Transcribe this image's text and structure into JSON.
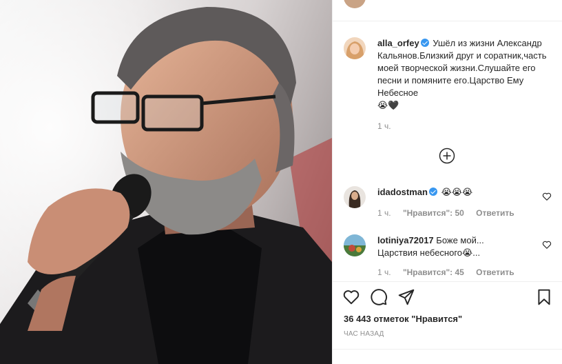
{
  "post": {
    "photo_alt": "",
    "author": "alla_orfey",
    "caption": "Ушёл из жизни Александр Кальянов.Близкий друг и соратник,часть моей творческой жизни.Слушайте его песни и помяните его.Царство Ему Небесное",
    "caption_emoji": "😭🖤",
    "caption_time": "1 ч.",
    "load_more_icon": "plus-circle-icon"
  },
  "comments": [
    {
      "username": "idadostman",
      "verified": true,
      "text": "😭😭😭",
      "time": "1 ч.",
      "likes": "\"Нравится\": 50",
      "reply": "Ответить"
    },
    {
      "username": "lotiniya72017",
      "verified": false,
      "text": "Боже мой... Царствия небесного😭...",
      "time": "1 ч.",
      "likes": "\"Нравится\": 45",
      "reply": "Ответить"
    }
  ],
  "actions": {
    "like_icon": "heart-icon",
    "comment_icon": "comment-icon",
    "share_icon": "share-icon",
    "save_icon": "bookmark-icon"
  },
  "likes_count": "36 443 отметок \"Нравится\"",
  "posted_time": "ЧАС НАЗАД",
  "colors": {
    "verified": "#3897f0",
    "secondary_text": "#8e8e8e",
    "primary_text": "#262626"
  }
}
